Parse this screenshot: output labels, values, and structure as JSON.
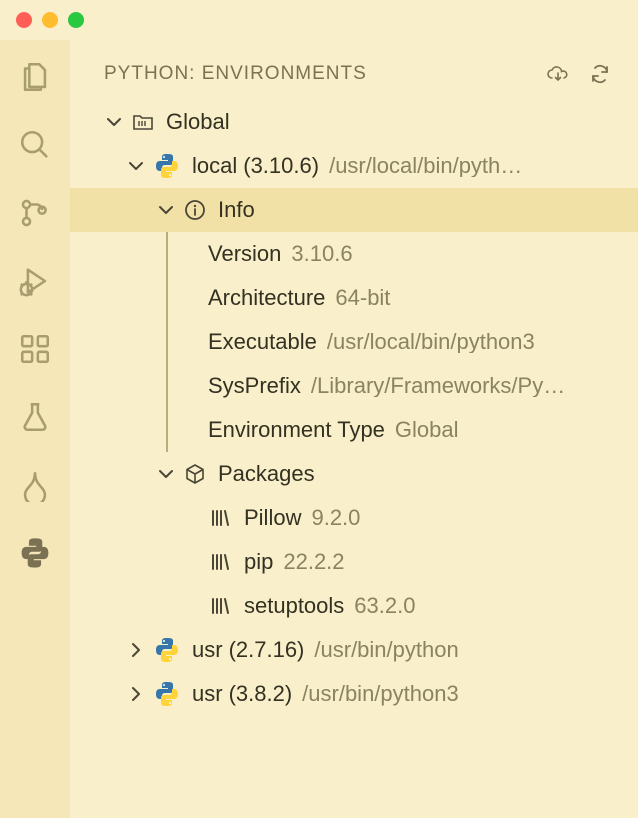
{
  "panel": {
    "title": "PYTHON: ENVIRONMENTS",
    "root": "Global",
    "environments": [
      {
        "name": "local",
        "version": "(3.10.6)",
        "path": "/usr/local/bin/pyth…",
        "info_label": "Info",
        "info": {
          "version_k": "Version",
          "version_v": "3.10.6",
          "arch_k": "Architecture",
          "arch_v": "64-bit",
          "exec_k": "Executable",
          "exec_v": "/usr/local/bin/python3",
          "sysprefix_k": "SysPrefix",
          "sysprefix_v": "/Library/Frameworks/Py…",
          "envtype_k": "Environment Type",
          "envtype_v": "Global"
        },
        "packages_label": "Packages",
        "packages": [
          {
            "name": "Pillow",
            "ver": "9.2.0"
          },
          {
            "name": "pip",
            "ver": "22.2.2"
          },
          {
            "name": "setuptools",
            "ver": "63.2.0"
          }
        ]
      },
      {
        "name": "usr",
        "version": "(2.7.16)",
        "path": "/usr/bin/python"
      },
      {
        "name": "usr",
        "version": "(3.8.2)",
        "path": "/usr/bin/python3"
      }
    ]
  }
}
